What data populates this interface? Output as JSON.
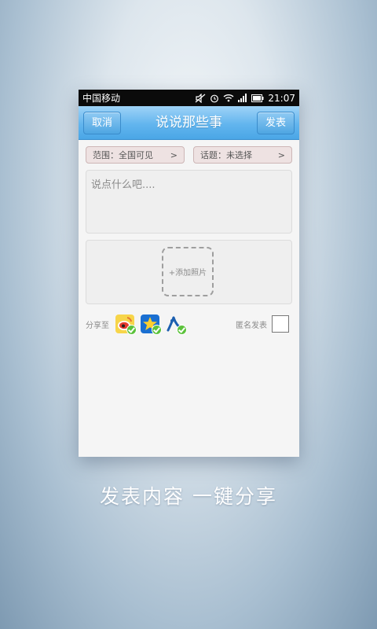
{
  "statusbar": {
    "carrier": "中国移动",
    "time": "21:07"
  },
  "titlebar": {
    "cancel_label": "取消",
    "title": "说说那些事",
    "publish_label": "发表"
  },
  "selectors": {
    "scope": {
      "label": "范围：全国可见",
      "arrow": ">"
    },
    "topic": {
      "label": "话题：未选择",
      "arrow": ">"
    }
  },
  "compose": {
    "placeholder": "说点什么吧...."
  },
  "photo": {
    "add_label": "+添加照片"
  },
  "share": {
    "label": "分享至",
    "targets": [
      {
        "icon": "sina-weibo-icon",
        "checked": true
      },
      {
        "icon": "qzone-icon",
        "checked": true
      },
      {
        "icon": "renren-icon",
        "checked": true
      }
    ]
  },
  "anonymous": {
    "label": "匿名发表",
    "checked": false
  },
  "caption": "发表内容 一键分享",
  "colors": {
    "titlebar_blue": "#4aa6e6",
    "selector_bg": "#eee2e2",
    "check_green": "#5cc23c"
  }
}
